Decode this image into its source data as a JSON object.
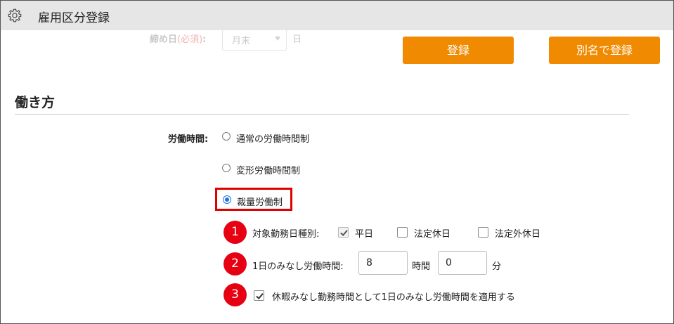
{
  "window": {
    "title": "雇用区分登録"
  },
  "ghost_row": {
    "label": "締め日",
    "required": "(必須)",
    "colon": ":",
    "select_value": "月末",
    "suffix": "日"
  },
  "buttons": {
    "register": "登録",
    "register_alias": "別名で登録"
  },
  "section": {
    "title": "働き方"
  },
  "work_time": {
    "label": "労働時間:",
    "options": [
      "通常の労働時間制",
      "変形労働時間制",
      "裁量労働制"
    ],
    "selected": "裁量労働制"
  },
  "callouts": [
    "1",
    "2",
    "3"
  ],
  "target_day": {
    "label": "対象勤務日種別:",
    "options": [
      {
        "label": "平日",
        "checked": true
      },
      {
        "label": "法定休日",
        "checked": false
      },
      {
        "label": "法定外休日",
        "checked": false
      }
    ]
  },
  "deemed_hours": {
    "label": "1日のみなし労働時間:",
    "hours": "8",
    "hours_unit": "時間",
    "minutes": "0",
    "minutes_unit": "分"
  },
  "leave_option": {
    "label": "休暇みなし勤務時間として1日のみなし労働時間を適用する",
    "checked": true
  },
  "colors": {
    "accent_button": "#f08a00",
    "highlight": "#e00000",
    "callout": "#e60012",
    "radio_selected": "#1a73e8"
  }
}
